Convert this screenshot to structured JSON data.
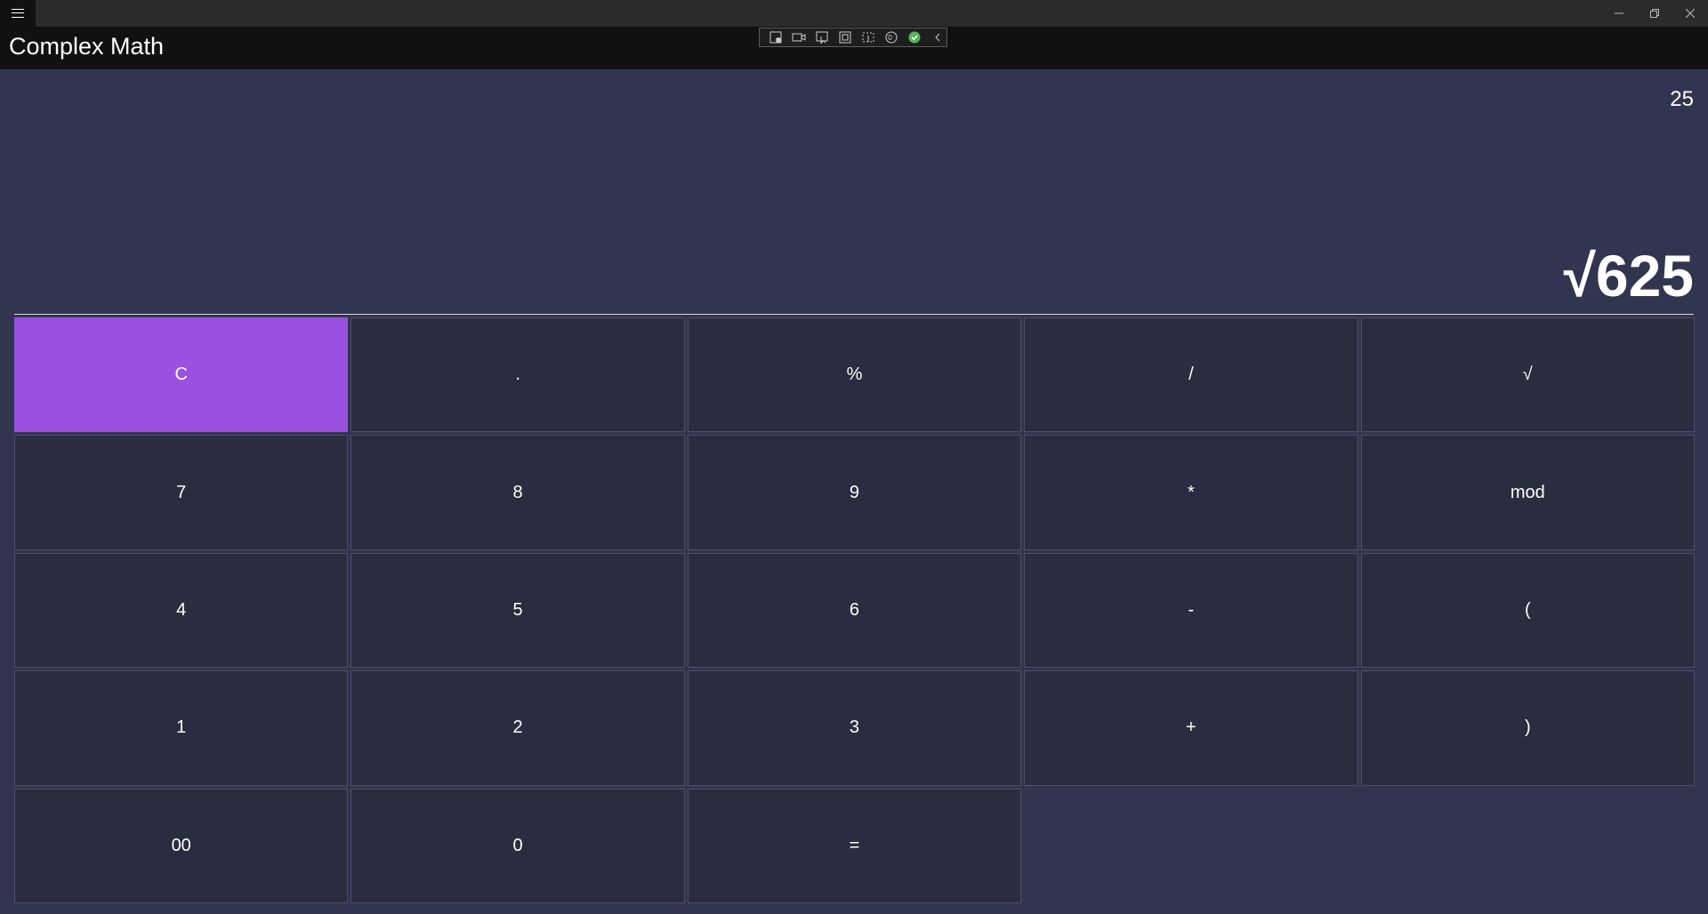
{
  "app": {
    "title": "Complex Math"
  },
  "display": {
    "result": "25",
    "expression": "√625"
  },
  "keypad": {
    "keys": [
      "C",
      ".",
      "%",
      "/",
      "√",
      "7",
      "8",
      "9",
      "*",
      "mod",
      "4",
      "5",
      "6",
      "-",
      "(",
      "1",
      "2",
      "3",
      "+",
      ")",
      "00",
      "0",
      "="
    ]
  },
  "colors": {
    "background": "#32354f",
    "key_background": "#2a2c40",
    "clear_accent": "#9b50e0",
    "app_bar": "#111111"
  }
}
